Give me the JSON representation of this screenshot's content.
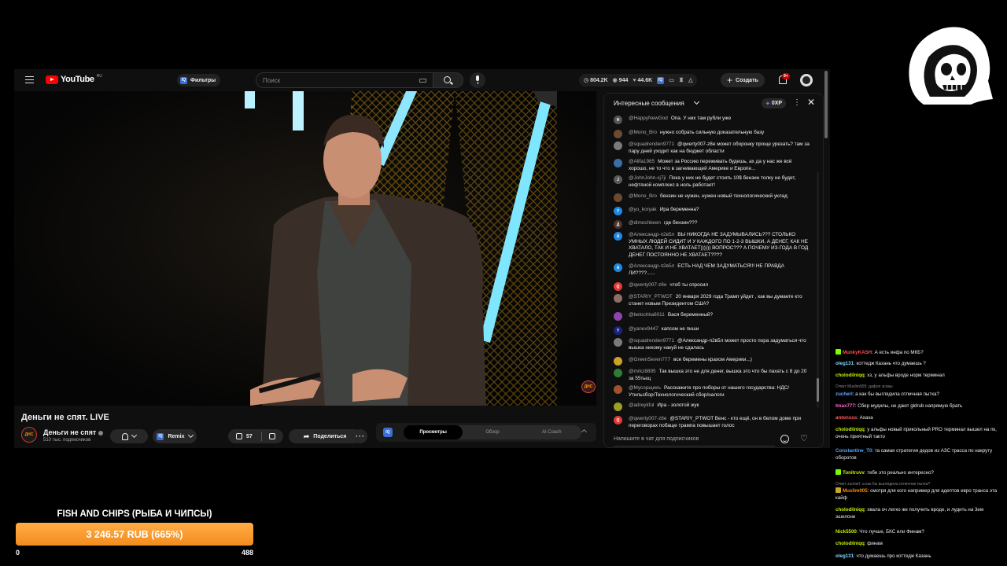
{
  "youtube": {
    "logo_text": "YouTube",
    "logo_region": "RU",
    "filters_label": "Фильтры",
    "search_placeholder": "Поиск",
    "stats": {
      "views": "804.2K",
      "viewers": "944",
      "likes": "44.6K"
    },
    "create_label": "Создать",
    "notifications_badge": "9+",
    "video": {
      "title": "Деньги не спят. LIVE",
      "channel_name": "Деньги не спят",
      "channel_subs": "510 тыс. подписчиков",
      "remix_label": "Remix",
      "likes": "57",
      "share_label": "Поделиться"
    },
    "coach": {
      "logo": "IQ",
      "tabs": [
        {
          "label": "Просмотры",
          "active": true
        },
        {
          "label": "Обзор",
          "active": false
        },
        {
          "label": "AI Coach",
          "active": false
        }
      ]
    },
    "chat": {
      "title": "Интересные сообщения",
      "xp": "0XP",
      "input_placeholder": "Напишите в чат для подписчиков",
      "messages": [
        {
          "author": "@HappyNewGod",
          "text": "Опа. У них там рубли уже",
          "avatar": "H",
          "color": "#555"
        },
        {
          "author": "@Mono_Bro",
          "text": "нужно собрать сильную доказательную базу",
          "avatar": "",
          "color": "#6b4a2f"
        },
        {
          "author": "@squadrenden9771",
          "text": "@qwerty007-z8e может оборонку проще урезать? там за пару дней уходит как на бюджет области",
          "avatar": "",
          "color": "#7a7a7a"
        },
        {
          "author": "@Allfa1985",
          "text": "Может за Россию переживать будешь, ах да у нас же всё хорошо, не то что в загнивающей Америке и Европе...",
          "avatar": "",
          "color": "#3a6ea5"
        },
        {
          "author": "@JohnJohn-xj7ji",
          "text": "Пока у них не будет стоить 10$ бензин толку не будет, нефтяной комплекс в ноль работает!",
          "avatar": "J",
          "color": "#5a5a5a"
        },
        {
          "author": "@Mono_Bro",
          "text": "бензин не нужен, нужен новый технологический уклад",
          "avatar": "",
          "color": "#6b4a2f"
        },
        {
          "author": "@yu_koryak",
          "text": "Ира беременна?",
          "avatar": "Y",
          "color": "#1e88e5"
        },
        {
          "author": "@dimochkeen",
          "text": "где бензин???",
          "avatar": "Д",
          "color": "#4e342e"
        },
        {
          "author": "@Александр-п2в5л",
          "text": "ВЫ НИКОГДА НЕ ЗАДУМЫВАЛИСЬ??? СТОЛЬКО УМНЫХ ЛЮДЕЙ СИДИТ И У КАЖДОГО ПО 1-2-3 ВЫШКИ, А ДЕНЕГ, КАК НЕ ХВАТАЛО, ТАК И НЕ ХВАТАЕТ)))))) ВОПРОС??? А ПОЧЕМУ ИЗ-ГОДА В ГОД ДЕНЕГ ПОСТОЯННО НЕ ХВАТАЕТ????",
          "avatar": "A",
          "color": "#1e88e5"
        },
        {
          "author": "@Александр-п2в5л",
          "text": "ЕСТЬ НАД ЧЕМ ЗАДУМАТЬСЯ!!! НЕ ПРАВДА ЛИ????......",
          "avatar": "A",
          "color": "#1e88e5"
        },
        {
          "author": "@qwerty007-z8e",
          "text": "чтоб ты спросил",
          "avatar": "Q",
          "color": "#e53935"
        },
        {
          "author": "@STARIY_PTWOT",
          "text": "20 января 2029 года Трамп уйдет , как вы думаете кто станет новым Президентом США?",
          "avatar": "",
          "color": "#8d6e63"
        },
        {
          "author": "@belochka6011",
          "text": "Вася беременный?",
          "avatar": "",
          "color": "#8e44ad"
        },
        {
          "author": "@yanex9447",
          "text": "капсом не пиши",
          "avatar": "Y",
          "color": "#1a237e"
        },
        {
          "author": "@squadrenden9771",
          "text": "@Александр-п2в5л может просто пора задуматься что вышка никому накуй не сдалась",
          "avatar": "",
          "color": "#7a7a7a"
        },
        {
          "author": "@GreenSeven777",
          "text": "все беремены крахом Америки...)",
          "avatar": "",
          "color": "#c9a227"
        },
        {
          "author": "@mrkz8895",
          "text": "Так вышка это не для денег, вышка это что бы пахать с 8 до 20 за 55тыщ",
          "avatar": "",
          "color": "#2e7d32"
        },
        {
          "author": "@Мусорщикъ",
          "text": "Расскажите про поборы от нашего государства: НДС/Утильсбор/Технологический сбор/налоги",
          "avatar": "",
          "color": "#a0522d"
        },
        {
          "author": "@adreykful",
          "text": "Ира - золотой жук",
          "avatar": "",
          "color": "#9e9d24"
        },
        {
          "author": "@qwerty007-z8e",
          "text": "@STARIY_PTWOT Венс - кто ещё, он в белом доме при переговорах побаще трампа повышает голос",
          "avatar": "Q",
          "color": "#e53935"
        }
      ]
    }
  },
  "overlay": {
    "channel_watermark": "ДНС",
    "stream_chat": [
      {
        "user": "MunkyKASH",
        "text": "А есть инфа по МКБ?",
        "color": "#ff4f4f",
        "badge": "#7cfc00"
      },
      {
        "user": "oleg131",
        "text": "коттедж Казань что думаешь ?",
        "color": "#7fd7ff"
      },
      {
        "user": "cholodilniqq",
        "text": "хз, у альфы вроде норм терминал",
        "color": "#c6f000"
      },
      {
        "reply": "Ответ Muslim005: дафол зсовы"
      },
      {
        "user": "zucherl",
        "text": "а как бы выглядила отличная пытка?",
        "color": "#62a8ff"
      },
      {
        "user": "tmax777",
        "text": "Сбер мудилы, не дают gldrub напрямую брать",
        "color": "#ff66cc"
      },
      {
        "user": "antonsss",
        "text": "Ахаха",
        "color": "#ff5c5c"
      },
      {
        "user": "cholodilniqq",
        "text": "у альфы новый прикольный PRO терминал вышел на пк, очень приятный такто",
        "color": "#c6f000"
      },
      {
        "user": "Constantine_T0",
        "text": "та самая стратегия дедов из АЗС трасса по накруту оборотов",
        "color": "#4fa3ff"
      },
      {
        "user": "Tonitruvv",
        "text": "тебе это реально интересно?",
        "color": "#c6f000",
        "badge": "#7cfc00"
      },
      {
        "reply": "Ответ zucherl: а как бы выглядила отличная пытка?"
      },
      {
        "user": "Muslim005",
        "text": "смотря для кого например для адептов евро транса эта кайф",
        "color": "#ff8c00",
        "badge": "#c9a227"
      },
      {
        "user": "cholodilniqq",
        "text": "хвала оч легко же получить вроде, и лудить на 3ем эшелоне",
        "color": "#c6f000"
      },
      {
        "user": "Nick5500",
        "text": "Что лучше, БКС или Финам?",
        "color": "#c6f000"
      },
      {
        "user": "cholodilniqq",
        "text": "финам",
        "color": "#c6f000"
      },
      {
        "user": "oleg131",
        "text": "что думаешь про коттедж Казань",
        "color": "#7fd7ff"
      }
    ],
    "goal": {
      "title": "FISH AND CHIPS (РЫБА И ЧИПСЫ)",
      "amount": "3 246.57 RUB (665%)",
      "min": "0",
      "max": "488",
      "progress_fraction": 1.0
    }
  }
}
